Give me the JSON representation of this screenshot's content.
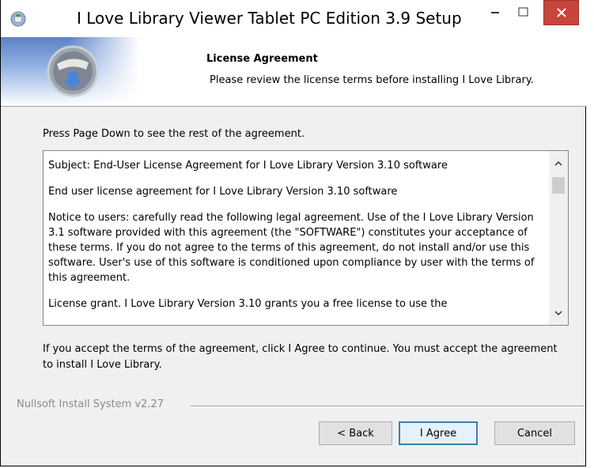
{
  "window": {
    "title": "I Love Library Viewer Tablet PC Edition 3.9 Setup",
    "minimize_icon": "minimize-icon",
    "maximize_icon": "maximize-icon",
    "close_icon": "close-icon",
    "close_color": "#c7453a"
  },
  "header": {
    "title": "License Agreement",
    "subtitle": "Please review the license terms before installing I Love Library."
  },
  "body": {
    "hint": "Press Page Down to see the rest of the agreement.",
    "license_paragraphs": [
      "Subject: End-User License Agreement for I Love Library Version 3.10 software",
      "End user license agreement for I Love Library Version 3.10 software",
      "Notice to users: carefully read the following legal agreement. Use of the I Love Library Version 3.1  software provided with this agreement (the \"SOFTWARE\") constitutes your acceptance of these terms. If you do not agree to the terms of this agreement, do not install and/or use this software. User's use of this software is conditioned upon compliance by user with the terms of this agreement.",
      "License grant. I Love Library Version 3.10 grants you a free license to use the"
    ],
    "accept_note": "If you accept the terms of the agreement, click I Agree to continue. You must accept the agreement to install I Love Library."
  },
  "footer": {
    "branding": "Nullsoft Install System v2.27",
    "back_label": "< Back",
    "agree_label": "I Agree",
    "cancel_label": "Cancel"
  }
}
